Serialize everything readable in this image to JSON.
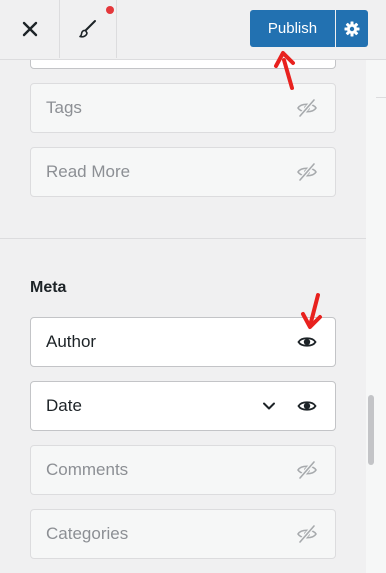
{
  "header": {
    "close_icon": "close-icon",
    "customize_icon": "paintbrush-icon",
    "publish_label": "Publish",
    "settings_icon": "gear-icon",
    "accent_color": "#2271b1",
    "notification_color": "#e4373b"
  },
  "sections": {
    "hidden_items": [
      {
        "label": "Tags",
        "visible": false
      },
      {
        "label": "Read More",
        "visible": false
      }
    ],
    "meta": {
      "title": "Meta",
      "items": [
        {
          "label": "Author",
          "visible": true
        },
        {
          "label": "Date",
          "visible": true,
          "expandable": true
        },
        {
          "label": "Comments",
          "visible": false
        },
        {
          "label": "Categories",
          "visible": false
        }
      ]
    }
  },
  "annotations": {
    "arrow_color": "#e8211e"
  }
}
